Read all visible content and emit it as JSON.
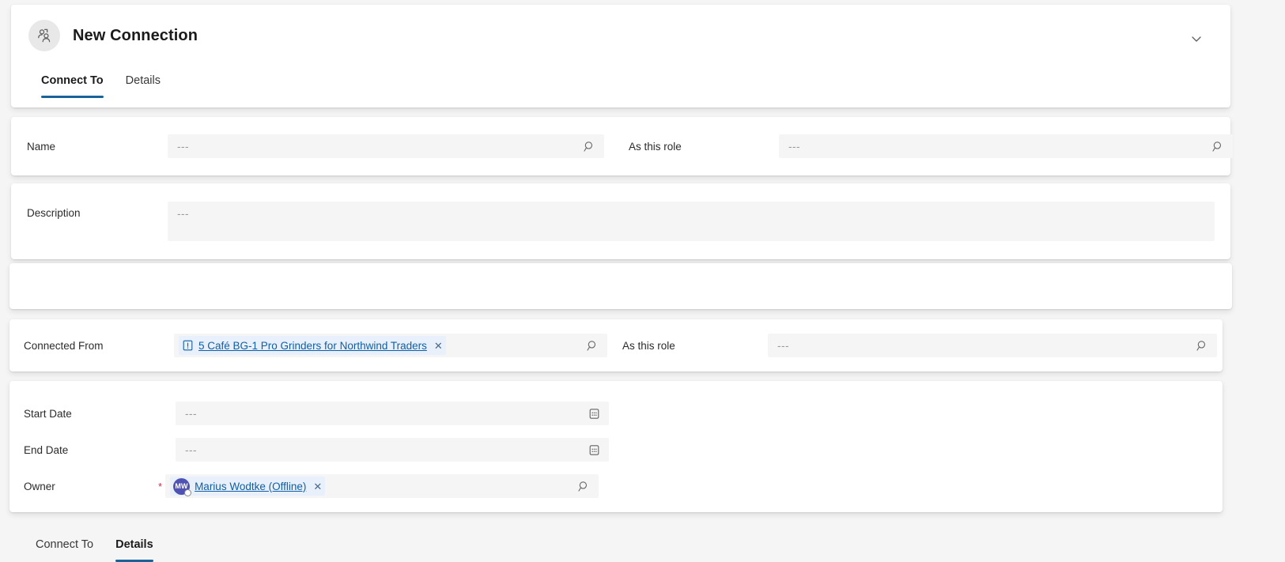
{
  "header": {
    "title": "New Connection",
    "entity_icon": "connection-people-icon",
    "collapse_icon": "chevron-down-icon",
    "tabs": [
      {
        "label": "Connect To",
        "active": true
      },
      {
        "label": "Details",
        "active": false
      }
    ]
  },
  "lower_tabs": [
    {
      "label": "Connect To",
      "active": false
    },
    {
      "label": "Details",
      "active": true
    }
  ],
  "fields": {
    "name": {
      "label": "Name",
      "value": "",
      "placeholder": "---",
      "icon": "search-icon"
    },
    "as_this_role_top": {
      "label": "As this role",
      "value": "",
      "placeholder": "---",
      "icon": "search-icon"
    },
    "description": {
      "label": "Description",
      "value": "",
      "placeholder": "---"
    },
    "connected_from": {
      "label": "Connected From",
      "icon": "search-icon",
      "chip": {
        "icon": "order-record-icon",
        "text": "5 Café BG-1 Pro Grinders for Northwind Traders",
        "remove_label": "✕"
      }
    },
    "as_this_role_details": {
      "label": "As this role",
      "value": "",
      "placeholder": "---",
      "icon": "search-icon"
    },
    "start_date": {
      "label": "Start Date",
      "value": "",
      "placeholder": "---",
      "icon": "calendar-icon"
    },
    "end_date": {
      "label": "End Date",
      "value": "",
      "placeholder": "---",
      "icon": "calendar-icon"
    },
    "owner": {
      "label": "Owner",
      "required_marker": "*",
      "icon": "search-icon",
      "chip": {
        "initials": "MW",
        "text": "Marius Wodtke (Offline)",
        "remove_label": "✕",
        "presence": "offline"
      }
    }
  },
  "colors": {
    "accent": "#1a6398",
    "link": "#115ea3",
    "chip_background": "#e8f1fb",
    "avatar_background": "#4f52b2",
    "required": "#c4314b",
    "page_background": "#f5f5f5",
    "input_background": "#f5f5f5"
  }
}
